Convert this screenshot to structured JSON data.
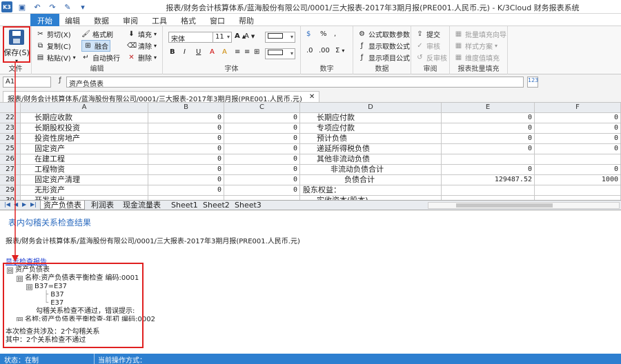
{
  "window": {
    "title": "报表/财务会计核算体系/蓝海股份有限公司/0001/三大报表-2017年3期月报(PRE001.人民币.元) - K/3Cloud 财务报表系统"
  },
  "menu": {
    "tabs": [
      "开始",
      "编辑",
      "数据",
      "审阅",
      "工具",
      "格式",
      "窗口",
      "帮助"
    ]
  },
  "ribbon": {
    "file": {
      "save": "保存(S)",
      "label": "文件"
    },
    "edit": {
      "cut": "剪切(X)",
      "copy": "复制(C)",
      "paste": "粘贴(V)",
      "format_painter": "格式刷",
      "merge": "融合",
      "wrap": "自动换行",
      "fill": "填充",
      "clear": "清除",
      "delete": "删除",
      "label": "编辑"
    },
    "font": {
      "family": "宋体",
      "size": "11",
      "label": "字体"
    },
    "number": {
      "percent": "%",
      "comma": ",",
      "label": "数字"
    },
    "data": {
      "formula_params": "公式取数参数",
      "show_params": "显示取数公式",
      "show_item_formula": "显示项目公式",
      "label": "数据"
    },
    "review": {
      "submit": "提交",
      "audit": "审核",
      "unaudit": "反审核",
      "label": "审阅"
    },
    "batch": {
      "wizard": "批量填充向导",
      "style": "样式方案",
      "dim": "维度值填充",
      "label": "报表批量填充"
    }
  },
  "formula_bar": {
    "cell": "A1",
    "value": "资产负债表"
  },
  "doc_tab": {
    "title": "报表/财务会计核算体系/蓝海股份有限公司/0001/三大报表-2017年3期月报(PRE001.人民币.元)"
  },
  "grid": {
    "columns": [
      "A",
      "B",
      "C",
      "D",
      "E",
      "F"
    ],
    "rows": [
      {
        "num": "22",
        "a": "长期应收款",
        "b": "0",
        "c": "0",
        "d": "长期应付款",
        "e": "0",
        "f": "0"
      },
      {
        "num": "23",
        "a": "长期股权投资",
        "b": "0",
        "c": "0",
        "d": "专项应付款",
        "e": "0",
        "f": "0"
      },
      {
        "num": "24",
        "a": "投资性房地产",
        "b": "0",
        "c": "0",
        "d": "预计负债",
        "e": "0",
        "f": "0"
      },
      {
        "num": "25",
        "a": "固定资产",
        "b": "0",
        "c": "0",
        "d": "递延所得税负债",
        "e": "0",
        "f": "0"
      },
      {
        "num": "26",
        "a": "在建工程",
        "b": "0",
        "c": "0",
        "d": "其他非流动负债",
        "e": "",
        "f": ""
      },
      {
        "num": "27",
        "a": "工程物资",
        "b": "0",
        "c": "0",
        "d": "非流动负债合计",
        "e": "0",
        "f": "0"
      },
      {
        "num": "28",
        "a": "固定资产清理",
        "b": "0",
        "c": "0",
        "d": "负债合计",
        "e": "129487.52",
        "f": "1000"
      },
      {
        "num": "29",
        "a": "无形资产",
        "b": "0",
        "c": "0",
        "d": "股东权益：",
        "e": "",
        "f": ""
      },
      {
        "num": "30",
        "a": "开发支出",
        "b": "",
        "c": "",
        "d": "实收资本(股本)",
        "e": "",
        "f": ""
      }
    ]
  },
  "sheets": [
    "资产负债表",
    "利润表",
    "现金流量表",
    "Sheet1",
    "Sheet2",
    "Sheet3"
  ],
  "result": {
    "title": "表内勾稽关系检查结果",
    "path": "报表/财务会计核算体系/蓝海股份有限公司/0001/三大报表-2017年3期月报(PRE001.人民币.元)",
    "report_link": "显示检查报告",
    "tree": [
      {
        "text": "资产负债表",
        "toggle": "⊟"
      },
      {
        "text": "名称:资产负债表平衡检查 编码:0001",
        "toggle": "⊟"
      },
      {
        "text": "B37=E37",
        "toggle": "⊟"
      },
      {
        "text": "B37",
        "toggle": ""
      },
      {
        "text": "E37",
        "toggle": ""
      },
      {
        "text": "勾稽关系检查不通过，错误提示:",
        "toggle": ""
      },
      {
        "text": "名称:资产负债表平衡检查-年初 编码:0002",
        "toggle": "⊟"
      }
    ],
    "summary_line1": "本次检查共涉及：2个勾稽关系",
    "summary_line2": "其中：2个关系检查不通过"
  },
  "status": {
    "state": "状态：在制",
    "current_op": "当前操作方式："
  },
  "colors": {
    "accent": "#2d7fd0",
    "highlight": "#e02020"
  }
}
